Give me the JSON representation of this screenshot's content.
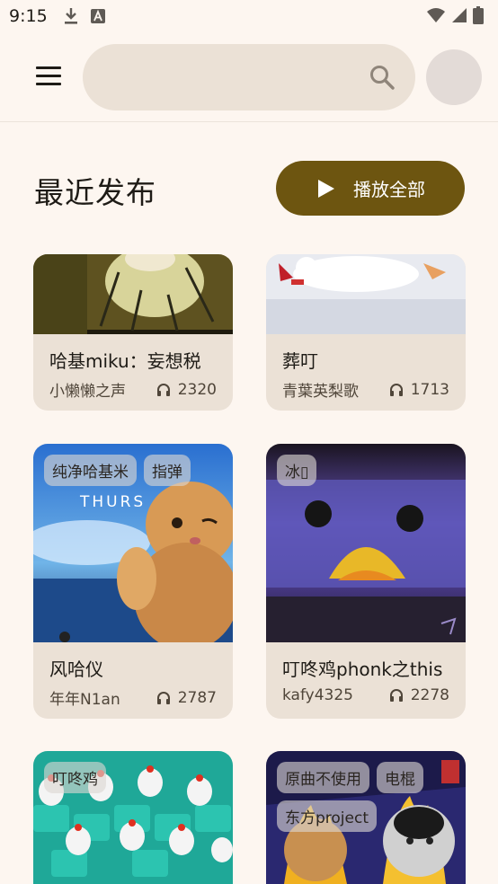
{
  "status": {
    "time": "9:15"
  },
  "search": {
    "placeholder": ""
  },
  "section": {
    "title": "最近发布",
    "play_all_label": "播放全部"
  },
  "cards": [
    {
      "title": "哈基miku：妄想税",
      "author": "小懒懒之声",
      "plays": "2320",
      "tags": []
    },
    {
      "title": "葬叮",
      "author": "青葉英梨歌",
      "plays": "1713",
      "tags": []
    },
    {
      "title": "风哈仪",
      "author": "年年N1an",
      "plays": "2787",
      "tags": [
        "纯净哈基米",
        "指弹"
      ]
    },
    {
      "title": "叮咚鸡phonk之this",
      "author": "kafy4325",
      "plays": "2278",
      "tags": [
        "冰▯"
      ]
    },
    {
      "title": "",
      "author": "",
      "plays": "",
      "tags": [
        "叮咚鸡"
      ]
    },
    {
      "title": "",
      "author": "",
      "plays": "",
      "tags": [
        "原曲不使用",
        "电棍",
        "东方project"
      ]
    }
  ],
  "colors": {
    "accent": "#6d5510",
    "surface": "#ebe1d6",
    "background": "#fdf6f0"
  }
}
